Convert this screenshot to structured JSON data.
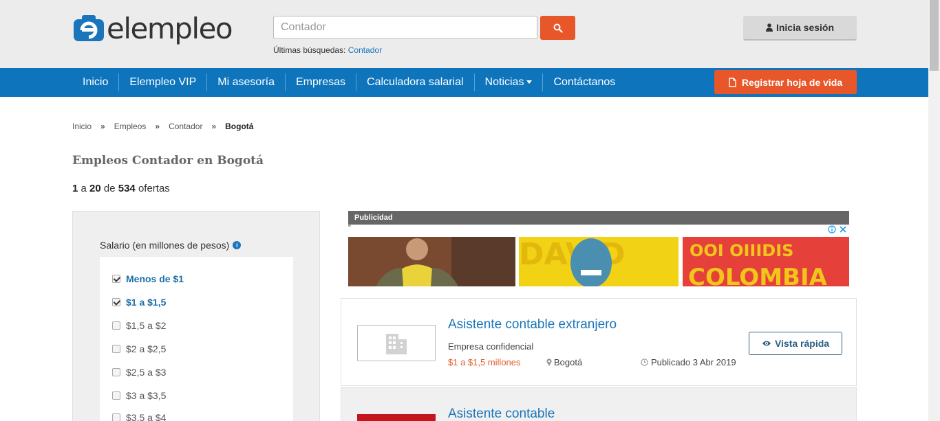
{
  "header": {
    "logo_text": "elempleo",
    "search": {
      "placeholder": "Contador",
      "value": ""
    },
    "recent_label": "Últimas búsquedas:",
    "recent_link": "Contador",
    "login_label": "Inicia sesión"
  },
  "nav": {
    "items": [
      {
        "label": "Inicio"
      },
      {
        "label": "Elempleo VIP"
      },
      {
        "label": "Mi asesoría"
      },
      {
        "label": "Empresas"
      },
      {
        "label": "Calculadora salarial"
      },
      {
        "label": "Noticias"
      },
      {
        "label": "Contáctanos"
      }
    ],
    "register_label": "Registrar hoja de vida"
  },
  "breadcrumb": {
    "items": [
      "Inicio",
      "Empleos",
      "Contador"
    ],
    "separator": "»",
    "current": "Bogotá"
  },
  "page_title": "Empleos Contador en Bogotá",
  "results": {
    "from": "1",
    "to": "20",
    "total": "534",
    "a": "a",
    "de": "de",
    "suffix": "ofertas"
  },
  "sidebar": {
    "filter_title": "Salario (en millones de pesos)",
    "options": [
      {
        "label": "Menos de $1",
        "checked": true
      },
      {
        "label": "$1 a $1,5",
        "checked": true
      },
      {
        "label": "$1,5 a $2",
        "checked": false
      },
      {
        "label": "$2 a $2,5",
        "checked": false
      },
      {
        "label": "$2,5 a $3",
        "checked": false
      },
      {
        "label": "$3 a $3,5",
        "checked": false
      },
      {
        "label": "$3,5 a $4",
        "checked": false
      }
    ]
  },
  "ad": {
    "label": "Publicidad",
    "quote": "\""
  },
  "jobs": [
    {
      "title": "Asistente contable extranjero",
      "company": "Empresa confidencial",
      "salary": "$1 a $1,5 millones",
      "location": "Bogotá",
      "date": "Publicado 3 Abr 2019",
      "quick_view": "Vista rápida"
    },
    {
      "title": "Asistente contable"
    }
  ],
  "colors": {
    "brand_blue": "#0e75bc",
    "accent_orange": "#e8572a",
    "link_blue": "#1a75bb"
  }
}
